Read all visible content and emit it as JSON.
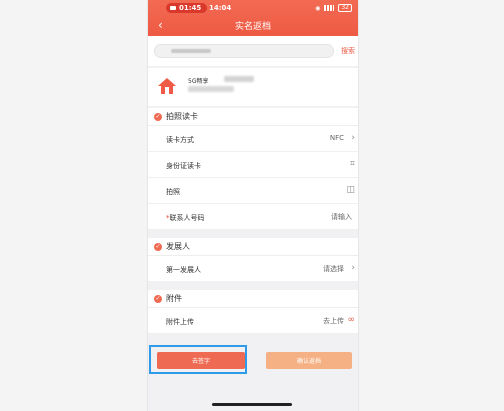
{
  "status_bar": {
    "recording_time": "01:45",
    "clock": "14:04",
    "battery": "32"
  },
  "header": {
    "title": "实名返档",
    "back_icon": "chevron-left-icon"
  },
  "search": {
    "placeholder": "",
    "button_label": "搜索"
  },
  "customer": {
    "name_prefix": "5G畅享"
  },
  "section_card_reading": {
    "title": "拍照读卡",
    "rows": [
      {
        "label": "读卡方式",
        "value": "NFC",
        "icon": "chevron-right-icon"
      },
      {
        "label": "身份证读卡",
        "value": "",
        "icon": "scan-icon"
      },
      {
        "label": "拍照",
        "value": "",
        "icon": "camera-icon"
      },
      {
        "required": "*",
        "label": "联系人号码",
        "value": "请输入",
        "icon": ""
      }
    ]
  },
  "section_developer": {
    "title": "发展人",
    "rows": [
      {
        "label": "第一发展人",
        "value": "请选择",
        "icon": "chevron-right-icon"
      }
    ]
  },
  "section_attachment": {
    "title": "附件",
    "rows": [
      {
        "label": "附件上传",
        "value": "去上传",
        "icon": "link-icon"
      }
    ]
  },
  "actions": {
    "sign_label": "去签字",
    "confirm_label": "确认返档"
  },
  "colors": {
    "brand": "#ee5a44",
    "highlight": "#2d9be8",
    "confirm": "#f5b183"
  }
}
